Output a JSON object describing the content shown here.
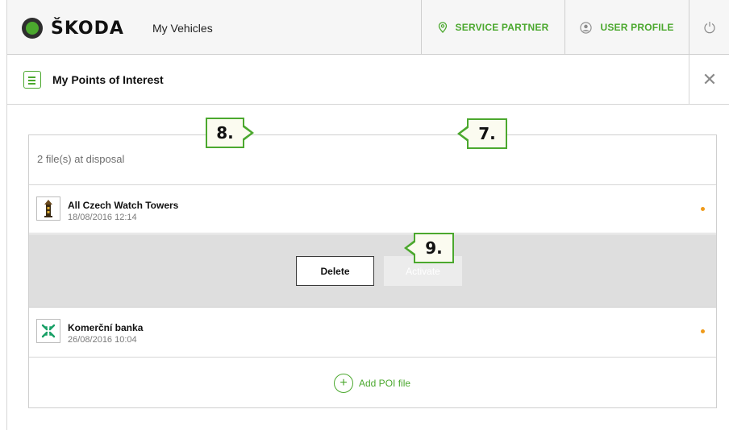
{
  "header": {
    "brand": "ŠKODA",
    "my_vehicles": "My Vehicles",
    "service_partner": "SERVICE PARTNER",
    "user_profile": "USER PROFILE",
    "power_icon": "power-icon"
  },
  "subheader": {
    "title": "My Points of Interest",
    "close_glyph": "✕"
  },
  "panel": {
    "files_count": "2 file(s) at disposal",
    "items": [
      {
        "name": "All Czech Watch Towers",
        "date": "18/08/2016 12:14",
        "icon": "tower-icon",
        "status_color": "#ef9a1a"
      },
      {
        "name": "Komerční banka",
        "date": "26/08/2016 10:04",
        "icon": "bank-logo-icon",
        "status_color": "#ef9a1a"
      }
    ],
    "actions": {
      "delete_label": "Delete",
      "activate_label": "Activate"
    },
    "add_label": "Add POI file"
  },
  "callouts": {
    "c8": "8.",
    "c7": "7.",
    "c9": "9."
  },
  "colors": {
    "accent": "#4ba82e",
    "status_dot": "#ef9a1a",
    "callout_bg": "#fbfbf0"
  }
}
